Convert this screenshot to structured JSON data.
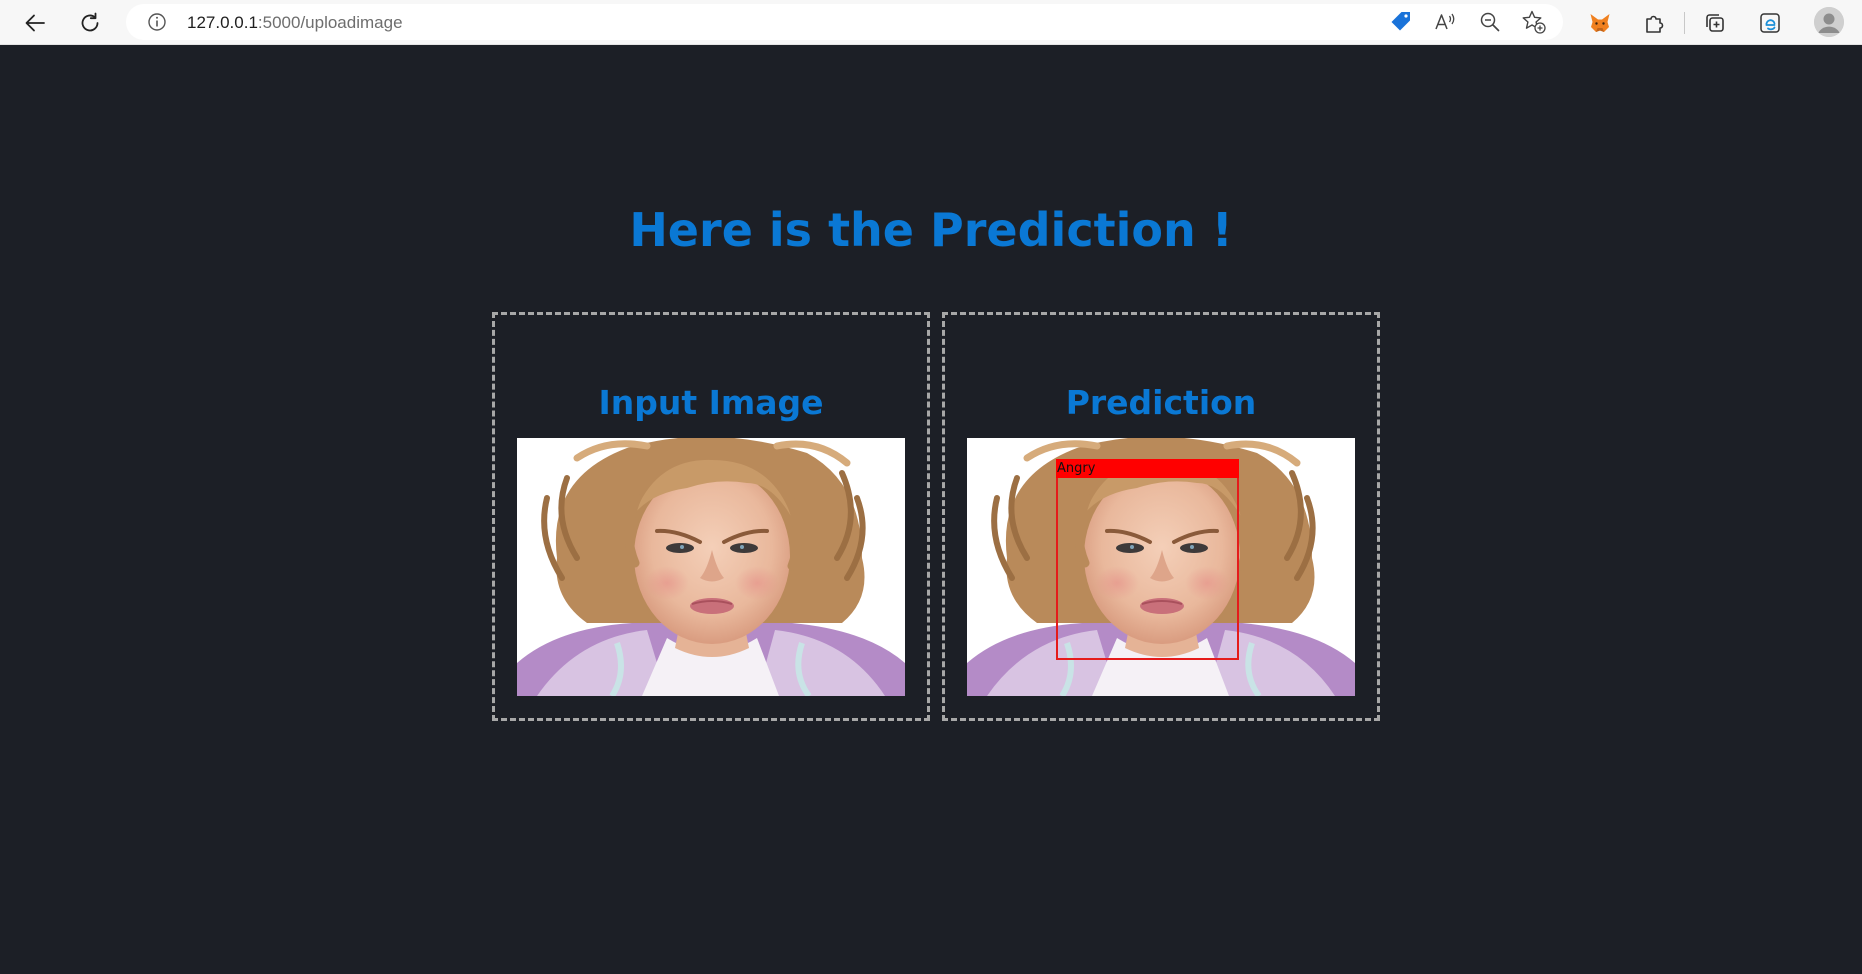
{
  "browser": {
    "url_host": "127.0.0.1",
    "url_path": ":5000/uploadimage",
    "icons": {
      "back": "back-arrow-icon",
      "refresh": "refresh-icon",
      "site_info": "info-icon",
      "shopping": "shopping-tag-icon",
      "read_aloud": "read-aloud-icon",
      "zoom": "zoom-out-icon",
      "favorite": "add-favorite-icon",
      "metamask": "fox-extension-icon",
      "extensions": "puzzle-extensions-icon",
      "collections": "collections-icon",
      "edge": "edge-icon",
      "profile": "profile-avatar-icon"
    },
    "accent_color": "#0a78d4"
  },
  "page": {
    "heading": "Here is the Prediction !",
    "background_color": "#1c1f26",
    "heading_color": "#0a78d4",
    "panels": [
      {
        "title": "Input Image"
      },
      {
        "title": "Prediction",
        "label": "Angry",
        "label_color": "#ff0000"
      }
    ]
  }
}
